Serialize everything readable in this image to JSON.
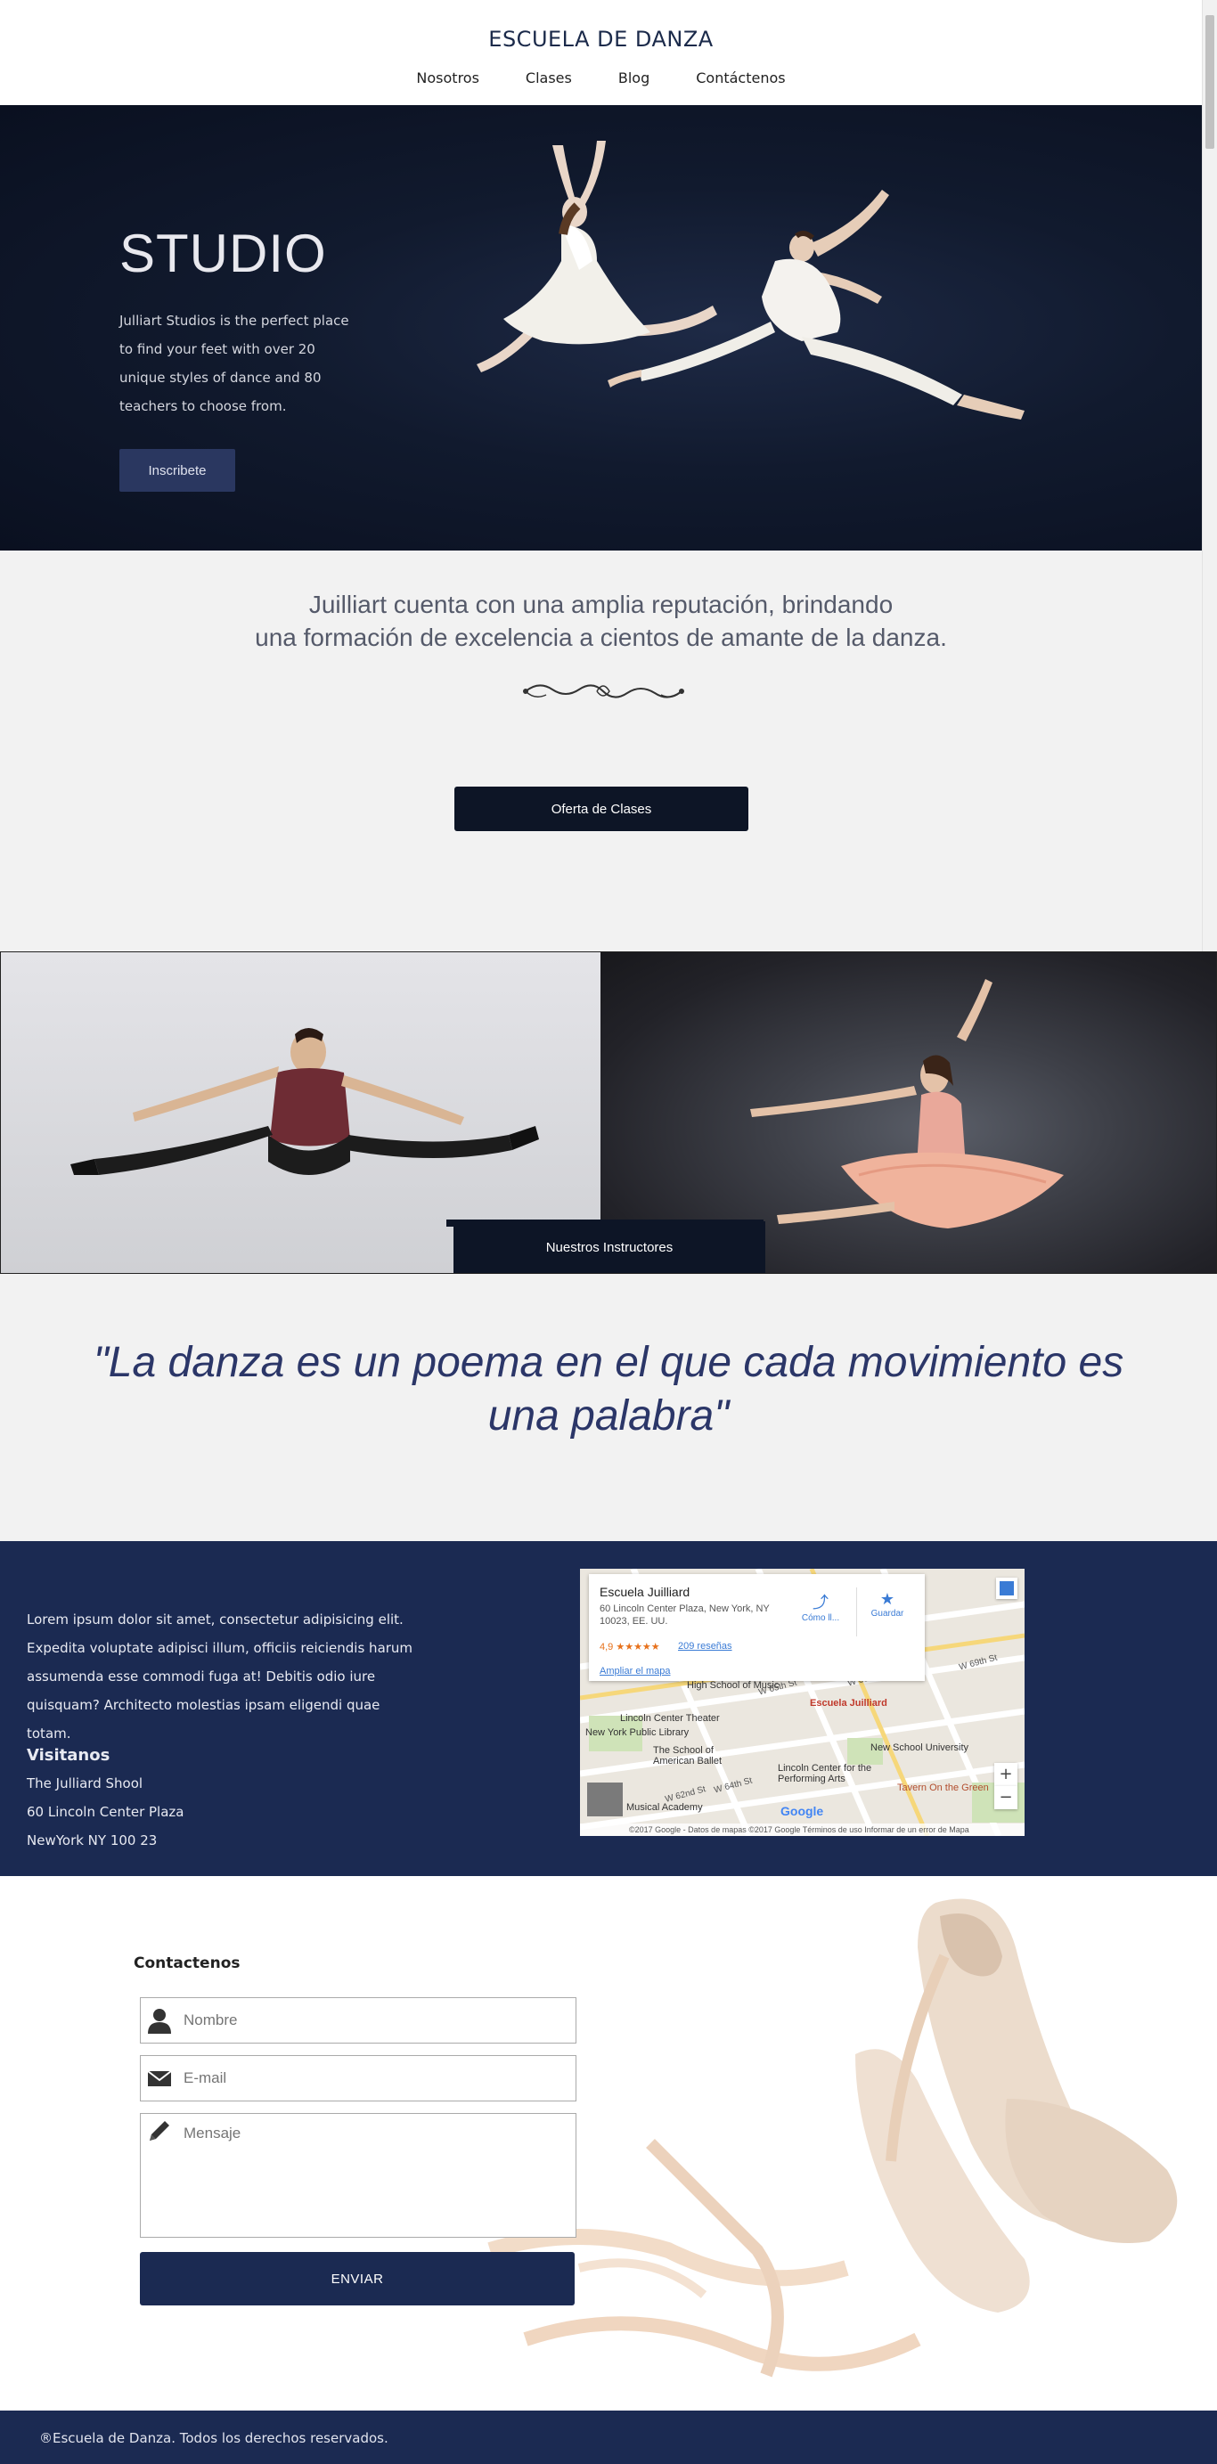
{
  "header": {
    "brand": "ESCUELA DE DANZA",
    "nav": [
      "Nosotros",
      "Clases",
      "Blog",
      "Contáctenos"
    ]
  },
  "hero": {
    "title": "STUDIO",
    "text": "Julliart Studios is the perfect place to find your feet with over 20 unique styles of dance and 80 teachers to choose from.",
    "button": "Inscribete"
  },
  "reputation": {
    "line1": "Juilliart cuenta con una amplia reputación, brindando",
    "line2": "una formación de excelencia a cientos de amante de la danza.",
    "button": "Oferta de Clases"
  },
  "gallery": {
    "button": "Nuestros Instructores"
  },
  "quote": "\"La danza es un poema en el que cada movimiento es una palabra\"",
  "info": {
    "lorem": "Lorem ipsum dolor sit amet, consectetur adipisicing elit. Expedita voluptate adipisci illum, officiis reiciendis harum assumenda esse commodi fuga at! Debitis odio iure quisquam? Architecto molestias ipsam eligendi quae totam.",
    "visit_heading": "Visitanos",
    "address": [
      "The Julliard Shool",
      "60 Lincoln Center Plaza",
      "NewYork NY 100 23"
    ]
  },
  "map": {
    "title": "Escuela Juilliard",
    "address": "60 Lincoln Center Plaza, New York, NY 10023, EE. UU.",
    "rating": "4,9 ★★★★★",
    "reviews": "209 reseñas",
    "enlarge": "Ampliar el mapa",
    "directions": "Cómo ll...",
    "save": "Guardar",
    "labels": [
      "High School of Music",
      "Escuela Juilliard",
      "Lincoln Center Theater",
      "New York Public Library",
      "The School of American Ballet",
      "New School University",
      "Lincoln Center for the Performing Arts",
      "Tavern On the Green",
      "Musical Academy"
    ],
    "street_labels": [
      "W 65th St",
      "W 66th St",
      "W 64th St",
      "W 69th St",
      "W 62nd St"
    ],
    "footer": "©2017 Google - Datos de mapas ©2017 Google   Términos de uso   Informar de un error de Mapa",
    "google": "Google"
  },
  "contact": {
    "heading": "Contactenos",
    "name_placeholder": "Nombre",
    "email_placeholder": "E-mail",
    "message_placeholder": "Mensaje",
    "send": "ENVIAR"
  },
  "footer": "®Escuela de Danza. Todos los derechos reservados.",
  "colors": {
    "navy": "#1b2a52",
    "dark_button": "#0d1526",
    "hero_button": "#2a3760",
    "quote_text": "#2b3668"
  },
  "icons": [
    "user-icon",
    "mail-icon",
    "pencil-icon",
    "flourish-ornament",
    "map-pin-icon",
    "directions-icon",
    "star-icon"
  ]
}
